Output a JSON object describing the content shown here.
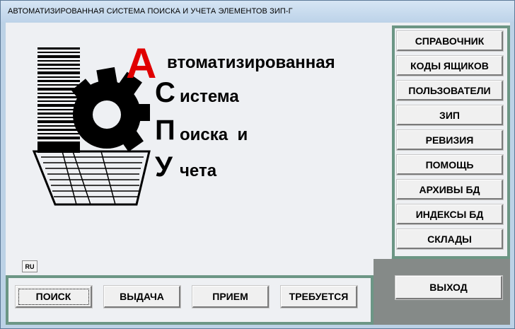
{
  "window": {
    "title": "АВТОМАТИЗИРОВАННАЯ СИСТЕМА ПОИСКА И УЧЕТА ЭЛЕМЕНТОВ ЗИП-Г"
  },
  "logo": {
    "letters": [
      "А",
      "С",
      "П",
      "У"
    ],
    "words": [
      "втоматизированная",
      "истема",
      "оиска  и",
      "чета"
    ],
    "colors": {
      "first_letter": "#e00000",
      "letters": "#000000"
    }
  },
  "side_menu": {
    "items": [
      {
        "label": "СПРАВОЧНИК"
      },
      {
        "label": "КОДЫ ЯЩИКОВ"
      },
      {
        "label": "ПОЛЬЗОВАТЕЛИ"
      },
      {
        "label": "ЗИП"
      },
      {
        "label": "РЕВИЗИЯ"
      },
      {
        "label": "ПОМОЩЬ"
      },
      {
        "label": "АРХИВЫ БД"
      },
      {
        "label": "ИНДЕКСЫ БД"
      },
      {
        "label": "СКЛАДЫ"
      }
    ]
  },
  "exit_button": {
    "label": "ВЫХОД"
  },
  "bottom_bar": {
    "buttons": [
      {
        "label": "ПОИСК"
      },
      {
        "label": "ВЫДАЧА"
      },
      {
        "label": "ПРИЕМ"
      },
      {
        "label": "ТРЕБУЕТСЯ"
      }
    ]
  },
  "language_indicator": "RU",
  "colors": {
    "panel_green": "#6c9685",
    "panel_gray": "#858a88",
    "background": "#eef0f3"
  }
}
